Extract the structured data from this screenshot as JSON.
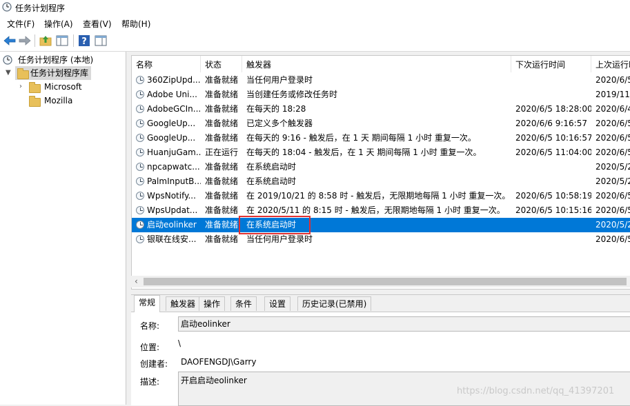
{
  "window": {
    "title": "任务计划程序"
  },
  "menu": [
    {
      "label": "文件(F)"
    },
    {
      "label": "操作(A)"
    },
    {
      "label": "查看(V)"
    },
    {
      "label": "帮助(H)"
    }
  ],
  "tree": {
    "root": "任务计划程序 (本地)",
    "library": "任务计划程序库",
    "children": [
      "Microsoft",
      "Mozilla"
    ]
  },
  "table": {
    "columns": [
      "名称",
      "状态",
      "触发器",
      "下次运行时间",
      "上次运行时"
    ],
    "rows": [
      {
        "name": "360ZipUpd...",
        "status": "准备就绪",
        "trigger": "当任何用户登录时",
        "next": "",
        "last": "2020/6/5"
      },
      {
        "name": "Adobe Uni...",
        "status": "准备就绪",
        "trigger": "当创建任务或修改任务时",
        "next": "",
        "last": "2019/11/"
      },
      {
        "name": "AdobeGCIn...",
        "status": "准备就绪",
        "trigger": "在每天的 18:28",
        "next": "2020/6/5 18:28:00",
        "last": "2020/6/4"
      },
      {
        "name": "GoogleUp...",
        "status": "准备就绪",
        "trigger": "已定义多个触发器",
        "next": "2020/6/6 9:16:57",
        "last": "2020/6/5"
      },
      {
        "name": "GoogleUp...",
        "status": "准备就绪",
        "trigger": "在每天的 9:16 - 触发后，在 1 天 期间每隔 1 小时 重复一次。",
        "next": "2020/6/5 10:16:57",
        "last": "2020/6/5"
      },
      {
        "name": "HuanjuGam...",
        "status": "正在运行",
        "trigger": "在每天的 18:04 - 触发后，在 1 天 期间每隔 1 小时 重复一次。",
        "next": "2020/6/5 11:04:00",
        "last": "2020/6/5"
      },
      {
        "name": "npcapwatc...",
        "status": "准备就绪",
        "trigger": "在系统启动时",
        "next": "",
        "last": "2020/5/2"
      },
      {
        "name": "PalmInputB...",
        "status": "准备就绪",
        "trigger": "在系统启动时",
        "next": "",
        "last": "2020/5/2"
      },
      {
        "name": "WpsNotify...",
        "status": "准备就绪",
        "trigger": "在 2019/10/21 的 8:58 时 - 触发后，无限期地每隔 1 小时 重复一次。",
        "next": "2020/6/5 10:58:19",
        "last": "2020/6/5"
      },
      {
        "name": "WpsUpdat...",
        "status": "准备就绪",
        "trigger": "在 2020/5/11 的 8:15 时 - 触发后，无限期地每隔 1 小时 重复一次。",
        "next": "2020/6/5 10:15:16",
        "last": "2020/6/5"
      },
      {
        "name": "启动eolinker",
        "status": "准备就绪",
        "trigger": "在系统启动时",
        "next": "",
        "last": "2020/5/2",
        "selected": true
      },
      {
        "name": "银联在线安...",
        "status": "准备就绪",
        "trigger": "当任何用户登录时",
        "next": "",
        "last": "2020/6/5"
      }
    ]
  },
  "tabs": [
    {
      "label": "常规",
      "active": true
    },
    {
      "label": "触发器"
    },
    {
      "label": "操作"
    },
    {
      "label": "条件"
    },
    {
      "label": "设置"
    },
    {
      "label": "历史记录(已禁用)"
    }
  ],
  "detail": {
    "name_label": "名称:",
    "name_value": "启动eolinker",
    "location_label": "位置:",
    "location_value": "\\",
    "author_label": "创建者:",
    "author_value": "DAOFENGDJ\\Garry",
    "description_label": "描述:",
    "description_value": "开启启动eolinker"
  },
  "watermark": "https://blog.csdn.net/qq_41397201",
  "colors": {
    "selection": "#0078d7",
    "highlight_box": "#e03030"
  }
}
